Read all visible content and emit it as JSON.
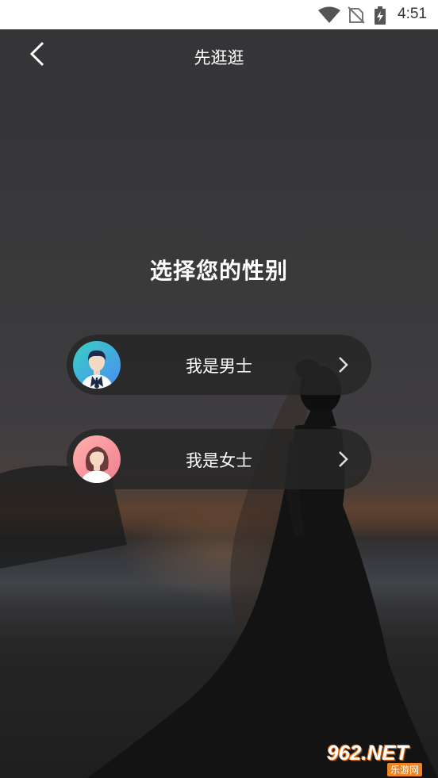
{
  "status_bar": {
    "time": "4:51",
    "icons": [
      "wifi-icon",
      "no-sim-icon",
      "battery-charging-icon"
    ]
  },
  "header": {
    "back_icon": "chevron-left-icon",
    "title": "先逛逛"
  },
  "main": {
    "headline": "选择您的性别",
    "options": [
      {
        "label": "我是男士",
        "avatar": "male-avatar-icon",
        "arrow": "chevron-right-icon"
      },
      {
        "label": "我是女士",
        "avatar": "female-avatar-icon",
        "arrow": "chevron-right-icon"
      }
    ]
  },
  "watermark": {
    "brand": "962.NET",
    "sub": "乐游网"
  },
  "colors": {
    "male_avatar_start": "#39d0c4",
    "male_avatar_end": "#4a8df2",
    "female_avatar_start": "#ffb0ae",
    "female_avatar_end": "#f07f8e",
    "pill_bg": "#262626",
    "text": "#ffffff"
  }
}
